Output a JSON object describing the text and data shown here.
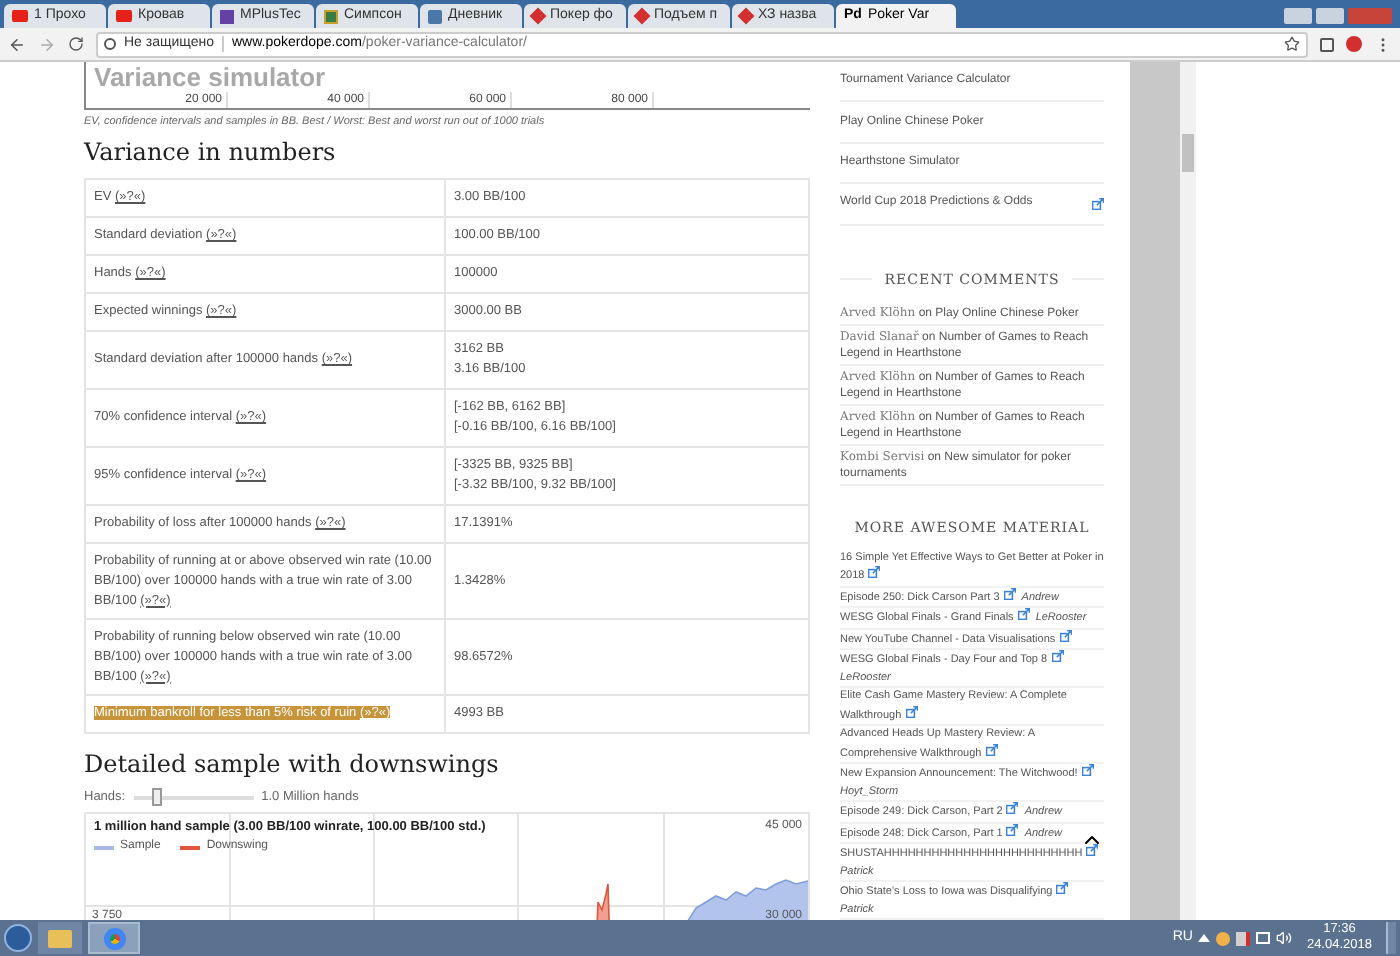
{
  "browser": {
    "tabs": [
      {
        "label": "1 Прохо",
        "kind": "video",
        "selected": false
      },
      {
        "label": "Кровав",
        "kind": "video",
        "selected": false
      },
      {
        "label": "MPlusTec",
        "kind": "stream",
        "selected": false
      },
      {
        "label": "Симпсон",
        "kind": "doc",
        "selected": false
      },
      {
        "label": "Дневник",
        "kind": "social",
        "selected": false
      },
      {
        "label": "Покер фо",
        "kind": "diamond",
        "selected": false
      },
      {
        "label": "Подъем п",
        "kind": "diamond",
        "selected": false
      },
      {
        "label": "ХЗ назва",
        "kind": "diamond",
        "selected": false
      },
      {
        "label": "Poker Var",
        "kind": "text",
        "logo_text": "Pd",
        "selected": true
      }
    ],
    "security": "Не защищено",
    "url_domain": "www.pokerdope.com",
    "url_path": "/poker-variance-calculator/"
  },
  "simulator_chart": {
    "title": "Variance simulator",
    "x_labels": [
      "20 000",
      "40 000",
      "60 000",
      "80 000"
    ],
    "caption": "EV, confidence intervals and samples in BB. Best / Worst: Best and worst run out of 1000 trials"
  },
  "numbers": {
    "heading": "Variance in numbers",
    "rows": [
      {
        "label": "EV",
        "help": "(»?«)",
        "values": [
          "3.00 BB/100"
        ],
        "highlighted": false
      },
      {
        "label": "Standard deviation",
        "help": "(»?«)",
        "values": [
          "100.00 BB/100"
        ],
        "highlighted": false
      },
      {
        "label": "Hands",
        "help": "(»?«)",
        "values": [
          "100000"
        ],
        "highlighted": false
      },
      {
        "label": "Expected winnings",
        "help": "(»?«)",
        "values": [
          "3000.00 BB"
        ],
        "highlighted": false
      },
      {
        "label": "Standard deviation after 100000 hands",
        "help": "(»?«)",
        "values": [
          "3162 BB",
          "3.16 BB/100"
        ],
        "highlighted": false
      },
      {
        "label": "70% confidence interval",
        "help": "(»?«)",
        "values": [
          "[-162 BB, 6162 BB]",
          "[-0.16 BB/100, 6.16 BB/100]"
        ],
        "highlighted": false
      },
      {
        "label": "95% confidence interval",
        "help": "(»?«)",
        "values": [
          "[-3325 BB, 9325 BB]",
          "[-3.32 BB/100, 9.32 BB/100]"
        ],
        "highlighted": false
      },
      {
        "label": "Probability of loss after 100000 hands",
        "help": "(»?«)",
        "values": [
          "17.1391%"
        ],
        "highlighted": false
      },
      {
        "label": "Probability of running at or above observed win rate (10.00 BB/100) over 100000 hands with a true win rate of 3.00 BB/100",
        "help": "(»?«)",
        "values": [
          "1.3428%"
        ],
        "highlighted": false
      },
      {
        "label": "Probability of running below observed win rate (10.00 BB/100) over 100000 hands with a true win rate of 3.00 BB/100",
        "help": "(»?«)",
        "values": [
          "98.6572%"
        ],
        "highlighted": false
      },
      {
        "label": "Minimum bankroll for less than 5% risk of ruin",
        "help": "(»?«)",
        "values": [
          "4993 BB"
        ],
        "highlighted": true
      }
    ]
  },
  "downswings": {
    "heading": "Detailed sample with downswings",
    "slider": {
      "label": "Hands:",
      "level": 0.15,
      "reading": "1.0 Million hands"
    },
    "chart": {
      "title": "1 million hand sample (3.00 BB/100 winrate, 100.00 BB/100 std.)",
      "legend": [
        {
          "name": "Sample",
          "color": "#a4b9e8"
        },
        {
          "name": "Downswing",
          "color": "#e0553e"
        }
      ],
      "left_label": "3 750",
      "right_labels": [
        "45 000",
        "30 000"
      ]
    }
  },
  "sidebar": {
    "links": [
      {
        "label": "Tournament Variance Calculator",
        "external": false
      },
      {
        "label": "Play Online Chinese Poker",
        "external": false
      },
      {
        "label": "Hearthstone Simulator",
        "external": false
      },
      {
        "label": "World Cup 2018 Predictions & Odds",
        "external": true
      }
    ],
    "comments_heading": "RECENT COMMENTS",
    "comments": [
      {
        "author": "Arved Klöhn",
        "text": "on Play Online Chinese Poker"
      },
      {
        "author": "David Slanař",
        "text": "on Number of Games to Reach Legend in Hearthstone"
      },
      {
        "author": "Arved Klöhn",
        "text": "on Number of Games to Reach Legend in Hearthstone"
      },
      {
        "author": "Arved Klöhn",
        "text": "on Number of Games to Reach Legend in Hearthstone"
      },
      {
        "author": "Kombi Servisi",
        "text": "on New simulator for poker tournaments"
      }
    ],
    "material_heading": "MORE AWESOME MATERIAL",
    "material": [
      {
        "title": "16 Simple Yet Effective Ways to Get Better at Poker in 2018"
      },
      {
        "title": "Episode 250: Dick Carson Part 3",
        "author": "Andrew"
      },
      {
        "title": "WESG Global Finals - Grand Finals",
        "author": "LeRooster"
      },
      {
        "title": "New YouTube Channel - Data Visualisations"
      },
      {
        "title": "WESG Global Finals - Day Four and Top 8",
        "author": "LeRooster"
      },
      {
        "title": "Elite Cash Game Mastery Review: A Complete Walkthrough"
      },
      {
        "title": "Advanced Heads Up Mastery Review: A Comprehensive Walkthrough"
      },
      {
        "title": "New Expansion Announcement: The Witchwood!",
        "author": "Hoyt_Storm"
      },
      {
        "title": "Episode 249: Dick Carson, Part 2",
        "author": "Andrew"
      },
      {
        "title": "Episode 248: Dick Carson, Part 1",
        "author": "Andrew"
      },
      {
        "title": "SHUSTAHHHHHHHHHHHHHHHHHHHHHHHHH",
        "author": "Patrick"
      },
      {
        "title": "Ohio State's Loss to Iowa was Disqualifying",
        "author": "Patrick"
      }
    ]
  },
  "taskbar": {
    "language": "RU",
    "time": "17:36",
    "date": "24.04.2018"
  }
}
